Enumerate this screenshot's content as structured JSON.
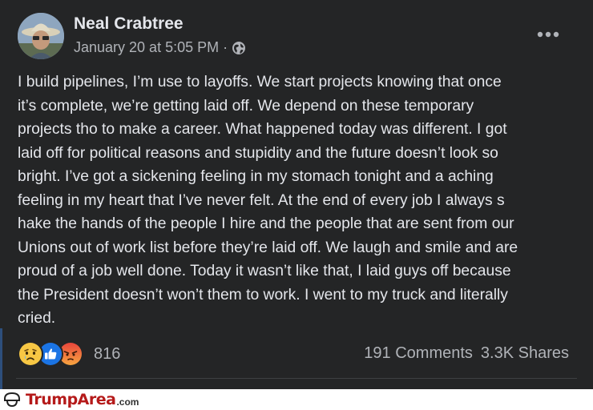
{
  "post": {
    "author": "Neal Crabtree",
    "timestamp": "January 20 at 5:05 PM",
    "separator": "·",
    "privacy_icon": "globe-icon",
    "more_icon": "more-horizontal-icon",
    "text_lines": [
      "I build pipelines, I’m use to layoffs. We start projects knowing that once",
      "it’s complete, we’re getting laid off. We depend on these temporary",
      "projects tho to make a career. What happened today was different. I got",
      "laid off for political reasons and stupidity and the future doesn’t look so",
      "bright. I’ve got a sickening feeling in my stomach tonight and a aching",
      "feeling in my heart that I’ve never felt. At the end of every job I always s",
      "hake the hands of the people I hire and the people that are sent from our",
      "Unions out of work list before they’re laid off. We laugh and smile and are",
      "proud of a job well done. Today it wasn’t like that, I laid guys off because",
      "the President doesn’t won’t them to work. I went to my truck and literally",
      "cried."
    ]
  },
  "reactions": {
    "icons": [
      "sad-reaction-icon",
      "like-reaction-icon",
      "angry-reaction-icon"
    ],
    "count": "816"
  },
  "stats": {
    "comments": "191 Comments",
    "shares": "3.3K Shares"
  },
  "watermark": {
    "brand": "TrumpArea",
    "suffix": ".com"
  },
  "colors": {
    "background": "#242526",
    "text_primary": "#e4e6eb",
    "text_secondary": "#b0b3b8",
    "watermark_red": "#b51a1a"
  }
}
